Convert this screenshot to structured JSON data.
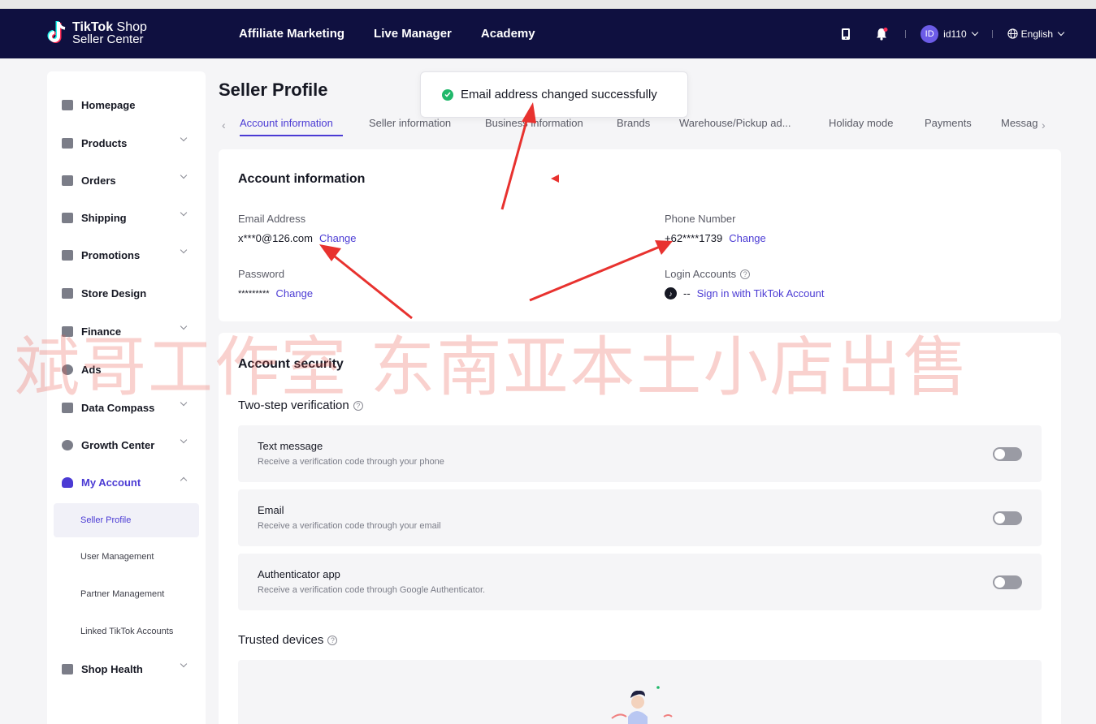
{
  "topbar": {
    "logo_line1_bold": "TikTok",
    "logo_line1_rest": " Shop",
    "logo_line2": "Seller Center",
    "nav": [
      "Affiliate Marketing",
      "Live Manager",
      "Academy"
    ],
    "avatar_text": "ID",
    "user": "id110",
    "language": "English",
    "bg_color": "#0f1040"
  },
  "sidebar": {
    "items": [
      {
        "label": "Homepage",
        "icon": "home-icon"
      },
      {
        "label": "Products",
        "icon": "box-icon"
      },
      {
        "label": "Orders",
        "icon": "orders-icon"
      },
      {
        "label": "Shipping",
        "icon": "truck-icon"
      },
      {
        "label": "Promotions",
        "icon": "megaphone-icon"
      },
      {
        "label": "Store Design",
        "icon": "store-icon"
      },
      {
        "label": "Finance",
        "icon": "wallet-icon"
      },
      {
        "label": "Ads",
        "icon": "ads-icon"
      },
      {
        "label": "Data Compass",
        "icon": "chart-icon"
      },
      {
        "label": "Growth Center",
        "icon": "medal-icon"
      },
      {
        "label": "My Account",
        "icon": "user-icon"
      },
      {
        "label": "Shop Health",
        "icon": "trophy-icon"
      }
    ],
    "sub_items": [
      "Seller Profile",
      "User Management",
      "Partner Management",
      "Linked TikTok Accounts"
    ]
  },
  "page": {
    "title": "Seller Profile",
    "tabs": [
      "Account information",
      "Seller information",
      "Business information",
      "Brands",
      "Warehouse/Pickup ad...",
      "Holiday mode",
      "Payments",
      "Messag"
    ]
  },
  "account_info": {
    "heading": "Account information",
    "email_label": "Email Address",
    "email_value": "x***0@126.com",
    "phone_label": "Phone Number",
    "phone_value": "+62****1739",
    "password_label": "Password",
    "password_value": "*********",
    "change": "Change",
    "login_label": "Login Accounts",
    "login_dash": "--",
    "login_link": "Sign in with TikTok Account"
  },
  "security": {
    "heading": "Account security",
    "two_step": "Two-step verification",
    "rows": [
      {
        "title": "Text message",
        "sub": "Receive a verification code through your phone"
      },
      {
        "title": "Email",
        "sub": "Receive a verification code through your email"
      },
      {
        "title": "Authenticator app",
        "sub": "Receive a verification code through Google Authenticator."
      }
    ],
    "trusted": "Trusted devices"
  },
  "toast": {
    "message": "Email address changed successfully"
  },
  "watermark": "斌哥工作室 东南亚本土小店出售",
  "colors": {
    "accent": "#4b3bd4",
    "success": "#21b86b",
    "arrow": "#e8322f"
  }
}
